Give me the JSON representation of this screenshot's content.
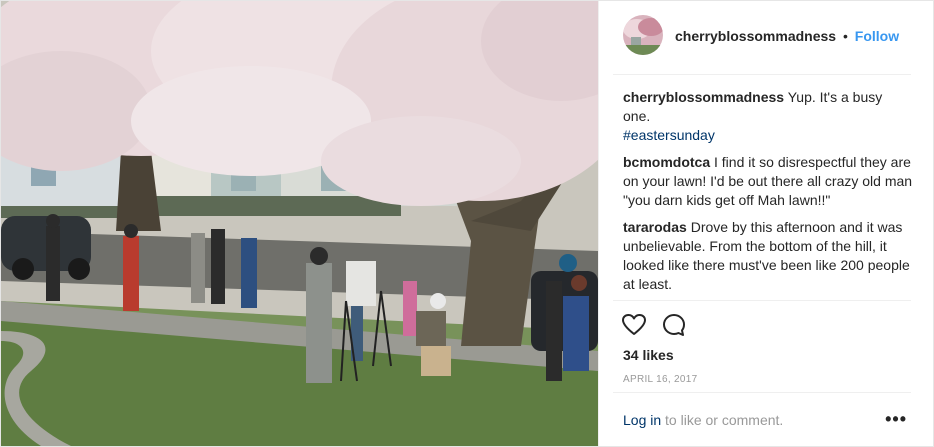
{
  "post": {
    "photo_description_icon": "photo",
    "author": {
      "username": "cherryblossommadness",
      "follow_label": "Follow",
      "separator": "•"
    },
    "comments": [
      {
        "user": "cherryblossommadness",
        "text": "Yup. It's a busy one.",
        "hashtag": "#eastersunday"
      },
      {
        "user": "bcmomdotca",
        "text": "I find it so disrespectful they are on your lawn! I'd be out there all crazy old man \"you darn kids get off Mah lawn!!\"",
        "hashtag": ""
      },
      {
        "user": "tararodas",
        "text": "Drove by this afternoon and it was unbelievable. From the bottom of the hill, it looked like there must've been like 200 people at least.",
        "hashtag": ""
      }
    ],
    "actions": {
      "like_icon": "heart-icon",
      "comment_icon": "comment-icon"
    },
    "likes": "34 likes",
    "date": "APRIL 16, 2017",
    "footer": {
      "login_link": "Log in",
      "login_rest": " to like or comment.",
      "more_label": "•••"
    }
  }
}
